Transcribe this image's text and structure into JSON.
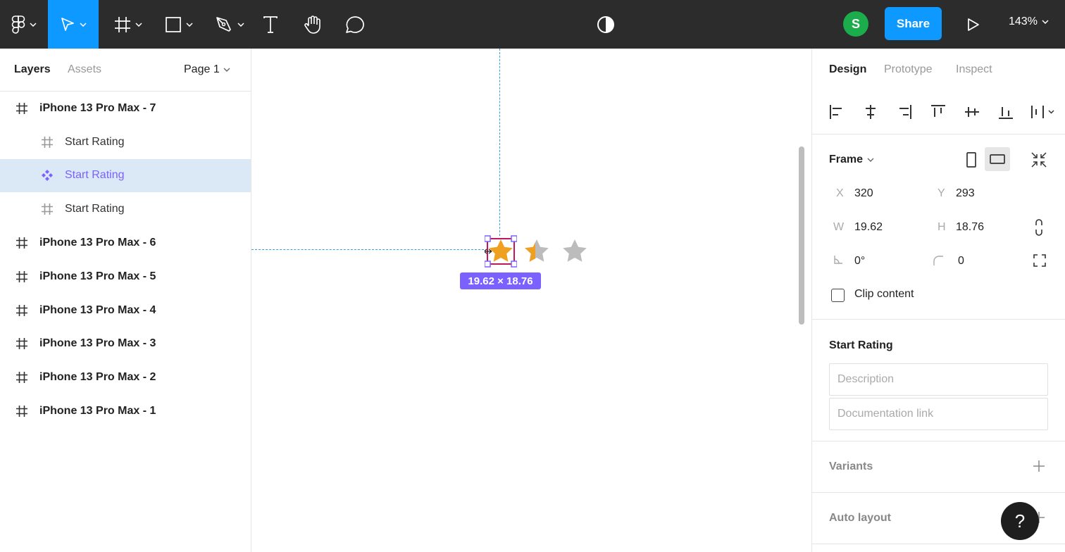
{
  "toolbar": {
    "icons": [
      "figma-menu-icon",
      "move-tool-icon",
      "frame-tool-icon",
      "shape-tool-icon",
      "pen-tool-icon",
      "text-tool-icon",
      "hand-tool-icon",
      "comment-tool-icon",
      "theme-toggle-icon",
      "present-icon"
    ],
    "avatar_initial": "S",
    "share_label": "Share",
    "zoom_label": "143%",
    "accent": "#0d99ff"
  },
  "left_panel": {
    "tabs": [
      "Layers",
      "Assets"
    ],
    "page_label": "Page 1",
    "layers": [
      {
        "name": "iPhone 13 Pro Max - 7",
        "kind": "frame",
        "level": 0,
        "selected": false
      },
      {
        "name": "Start Rating",
        "kind": "frame",
        "level": 1,
        "selected": false
      },
      {
        "name": "Start Rating",
        "kind": "component",
        "level": 1,
        "selected": true
      },
      {
        "name": "Start Rating",
        "kind": "frame",
        "level": 1,
        "selected": false
      },
      {
        "name": "iPhone 13 Pro Max - 6",
        "kind": "frame",
        "level": 0,
        "selected": false
      },
      {
        "name": "iPhone 13 Pro Max - 5",
        "kind": "frame",
        "level": 0,
        "selected": false
      },
      {
        "name": "iPhone 13 Pro Max - 4",
        "kind": "frame",
        "level": 0,
        "selected": false
      },
      {
        "name": "iPhone 13 Pro Max - 3",
        "kind": "frame",
        "level": 0,
        "selected": false
      },
      {
        "name": "iPhone 13 Pro Max - 2",
        "kind": "frame",
        "level": 0,
        "selected": false
      },
      {
        "name": "iPhone 13 Pro Max - 1",
        "kind": "frame",
        "level": 0,
        "selected": false
      }
    ]
  },
  "canvas": {
    "size_badge": "19.62 × 18.76",
    "stars": [
      "full",
      "half",
      "empty"
    ],
    "star_color": "#f0a020",
    "empty_star_color": "#bcbcbc",
    "selection_color": "#7b61ff"
  },
  "right_panel": {
    "tabs": [
      "Design",
      "Prototype",
      "Inspect"
    ],
    "frame": {
      "title": "Frame",
      "x_label": "X",
      "x": "320",
      "y_label": "Y",
      "y": "293",
      "w_label": "W",
      "w": "19.62",
      "h_label": "H",
      "h": "18.76",
      "rotation": "0°",
      "radius": "0",
      "clip_label": "Clip content"
    },
    "component": {
      "title": "Start Rating",
      "description_placeholder": "Description",
      "doc_link_placeholder": "Documentation link"
    },
    "variants_label": "Variants",
    "auto_layout_label": "Auto layout"
  },
  "help_label": "?"
}
